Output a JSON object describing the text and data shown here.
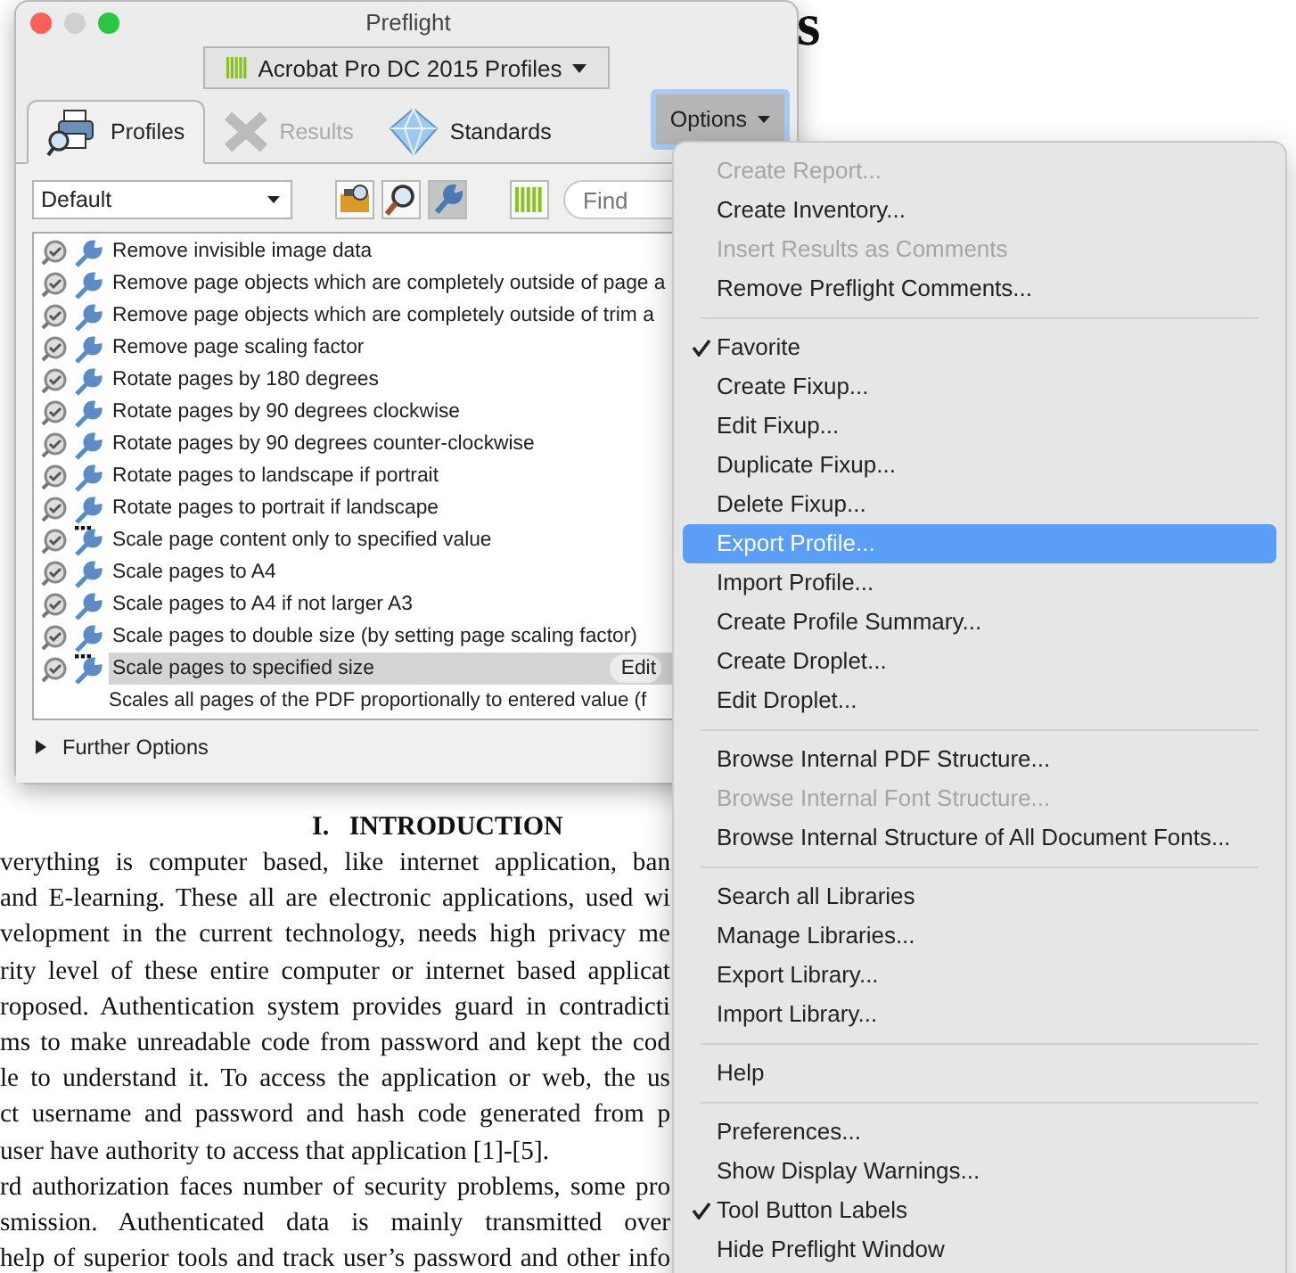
{
  "document": {
    "heading_fragment": "s",
    "heading": "I.   INTRODUCTION",
    "lines": [
      {
        "text": "verything is computer based, like internet application, ban",
        "justify": true
      },
      {
        "text": "and E-learning. These all are electronic applications, used wi",
        "justify": true
      },
      {
        "text": "velopment in the current technology, needs high privacy me",
        "justify": true
      },
      {
        "text": "rity level of these entire computer or internet based applicat",
        "justify": true
      },
      {
        "text": "roposed. Authentication system provides guard in contradicti",
        "justify": true
      },
      {
        "text": "ms to make unreadable code from password and kept the cod",
        "justify": true
      },
      {
        "text": "le to understand it. To access the application or web, the us",
        "justify": true
      },
      {
        "text": "ct username and password and hash code generated from p",
        "justify": true
      },
      {
        "text": "user have authority to access that application [1]-[5].",
        "justify": false
      },
      {
        "text": "rd authorization faces number of security problems, some pro",
        "justify": true
      },
      {
        "text": "smission. Authenticated data is mainly transmitted over",
        "justify": true
      },
      {
        "text": "help of superior tools and track user’s password and other info",
        "justify": true
      }
    ]
  },
  "window": {
    "title": "Preflight",
    "library": "Acrobat Pro DC 2015 Profiles",
    "tabs": [
      {
        "kind": "profiles",
        "label": "Profiles",
        "selected": true,
        "disabled": false
      },
      {
        "kind": "results",
        "label": "Results",
        "selected": false,
        "disabled": true
      },
      {
        "kind": "standards",
        "label": "Standards",
        "selected": false,
        "disabled": false
      }
    ],
    "options_button": "Options",
    "filter": "Default",
    "tools": [
      {
        "kind": "briefcase",
        "selected": false
      },
      {
        "kind": "magnifier",
        "selected": false
      },
      {
        "kind": "wrench",
        "selected": true
      }
    ],
    "find_placeholder": "Find",
    "fixups": [
      {
        "name": "Remove invisible image data",
        "has_parameters": false,
        "selected": false
      },
      {
        "name": "Remove page objects which are completely outside of page a",
        "has_parameters": false,
        "selected": false
      },
      {
        "name": "Remove page objects which are completely outside of trim a",
        "has_parameters": false,
        "selected": false
      },
      {
        "name": "Remove page scaling factor",
        "has_parameters": false,
        "selected": false
      },
      {
        "name": "Rotate pages by 180 degrees",
        "has_parameters": false,
        "selected": false
      },
      {
        "name": "Rotate pages by 90 degrees clockwise",
        "has_parameters": false,
        "selected": false
      },
      {
        "name": "Rotate pages by 90 degrees counter-clockwise",
        "has_parameters": false,
        "selected": false
      },
      {
        "name": "Rotate pages to landscape if portrait",
        "has_parameters": false,
        "selected": false
      },
      {
        "name": "Rotate pages to portrait if landscape",
        "has_parameters": false,
        "selected": false
      },
      {
        "name": "Scale page content only to specified value",
        "has_parameters": true,
        "selected": false
      },
      {
        "name": "Scale pages to A4",
        "has_parameters": false,
        "selected": false
      },
      {
        "name": "Scale pages to A4 if not larger A3",
        "has_parameters": false,
        "selected": false
      },
      {
        "name": "Scale pages to double size (by setting page scaling factor)",
        "has_parameters": false,
        "selected": false
      },
      {
        "name": "Scale pages to specified size",
        "has_parameters": true,
        "selected": true
      }
    ],
    "edit_button": "Edit",
    "description": "Scales all pages of the PDF proportionally to entered value (f",
    "further_options": "Further Options",
    "further_expanded": false
  },
  "menu": [
    {
      "kind": "item",
      "label": "Create Report...",
      "disabled": true,
      "checked": false,
      "selected": false
    },
    {
      "kind": "item",
      "label": "Create Inventory...",
      "disabled": false,
      "checked": false,
      "selected": false
    },
    {
      "kind": "item",
      "label": "Insert Results as Comments",
      "disabled": true,
      "checked": false,
      "selected": false
    },
    {
      "kind": "item",
      "label": "Remove Preflight Comments...",
      "disabled": false,
      "checked": false,
      "selected": false
    },
    {
      "kind": "separator"
    },
    {
      "kind": "item",
      "label": "Favorite",
      "disabled": false,
      "checked": true,
      "selected": false
    },
    {
      "kind": "item",
      "label": "Create Fixup...",
      "disabled": false,
      "checked": false,
      "selected": false
    },
    {
      "kind": "item",
      "label": "Edit Fixup...",
      "disabled": false,
      "checked": false,
      "selected": false
    },
    {
      "kind": "item",
      "label": "Duplicate Fixup...",
      "disabled": false,
      "checked": false,
      "selected": false
    },
    {
      "kind": "item",
      "label": "Delete Fixup...",
      "disabled": false,
      "checked": false,
      "selected": false
    },
    {
      "kind": "item",
      "label": "Export Profile...",
      "disabled": false,
      "checked": false,
      "selected": true
    },
    {
      "kind": "item",
      "label": "Import Profile...",
      "disabled": false,
      "checked": false,
      "selected": false
    },
    {
      "kind": "item",
      "label": "Create Profile Summary...",
      "disabled": false,
      "checked": false,
      "selected": false
    },
    {
      "kind": "item",
      "label": "Create Droplet...",
      "disabled": false,
      "checked": false,
      "selected": false
    },
    {
      "kind": "item",
      "label": "Edit Droplet...",
      "disabled": false,
      "checked": false,
      "selected": false
    },
    {
      "kind": "separator"
    },
    {
      "kind": "item",
      "label": "Browse Internal PDF Structure...",
      "disabled": false,
      "checked": false,
      "selected": false
    },
    {
      "kind": "item",
      "label": "Browse Internal Font Structure...",
      "disabled": true,
      "checked": false,
      "selected": false
    },
    {
      "kind": "item",
      "label": "Browse Internal Structure of All Document Fonts...",
      "disabled": false,
      "checked": false,
      "selected": false
    },
    {
      "kind": "separator"
    },
    {
      "kind": "item",
      "label": "Search all Libraries",
      "disabled": false,
      "checked": false,
      "selected": false
    },
    {
      "kind": "item",
      "label": "Manage Libraries...",
      "disabled": false,
      "checked": false,
      "selected": false
    },
    {
      "kind": "item",
      "label": "Export Library...",
      "disabled": false,
      "checked": false,
      "selected": false
    },
    {
      "kind": "item",
      "label": "Import Library...",
      "disabled": false,
      "checked": false,
      "selected": false
    },
    {
      "kind": "separator"
    },
    {
      "kind": "item",
      "label": "Help",
      "disabled": false,
      "checked": false,
      "selected": false
    },
    {
      "kind": "separator"
    },
    {
      "kind": "item",
      "label": "Preferences...",
      "disabled": false,
      "checked": false,
      "selected": false
    },
    {
      "kind": "item",
      "label": "Show Display Warnings...",
      "disabled": false,
      "checked": false,
      "selected": false
    },
    {
      "kind": "item",
      "label": "Tool Button Labels",
      "disabled": false,
      "checked": true,
      "selected": false
    },
    {
      "kind": "item",
      "label": "Hide Preflight Window",
      "disabled": false,
      "checked": false,
      "selected": false
    }
  ]
}
